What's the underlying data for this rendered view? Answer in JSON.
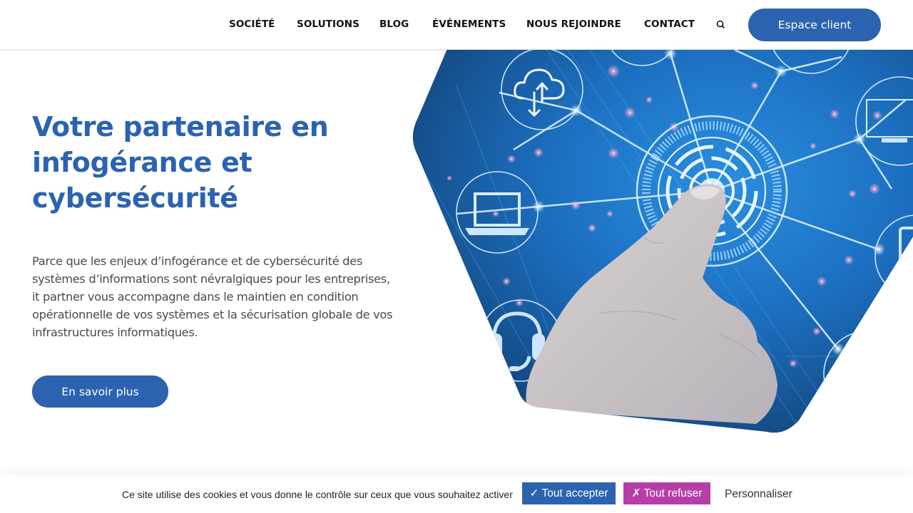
{
  "header": {
    "nav": [
      {
        "label": "SOCIÉTÉ"
      },
      {
        "label": "SOLUTIONS"
      },
      {
        "label": "BLOG"
      },
      {
        "label": "ÉVÉNEMENTS"
      },
      {
        "label": "NOUS REJOINDRE"
      },
      {
        "label": "CONTACT"
      }
    ],
    "search_icon": "search-icon",
    "client_button": "Espace client"
  },
  "hero": {
    "title_lines": [
      "Votre partenaire en",
      "infogérance et",
      "cybersécurité"
    ],
    "text_lines": [
      "Parce que les enjeux d’infogérance et de cybersécurité des",
      "systèmes d’informations sont névralgiques pour les entreprises,",
      "it partner vous accompagne dans le maintien en condition",
      "opérationnelle de vos systèmes et la sécurisation globale de vos",
      "infrastructures informatiques."
    ],
    "cta_label": "En savoir plus",
    "image_icons": [
      "cloud-sync-icon",
      "laptop-icon",
      "headset-icon",
      "monitor-icon",
      "globe-icon",
      "tablet-icon"
    ]
  },
  "cookie_banner": {
    "text": "Ce site utilise des cookies et vous donne le contrôle sur ceux que vous souhaitez activer",
    "accept_label": "✓ Tout accepter",
    "refuse_label": "✗ Tout refuser",
    "customize_label": "Personnaliser"
  },
  "colors": {
    "brand_blue": "#2b63b1",
    "refuse_magenta": "#b73ea8",
    "nav_text": "#111111",
    "body_text": "#4a4a4a"
  }
}
